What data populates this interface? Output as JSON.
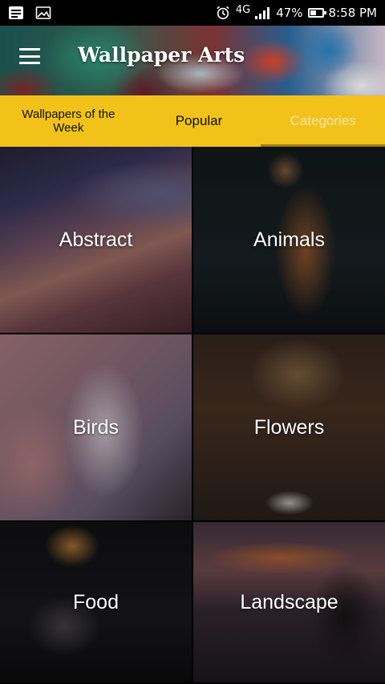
{
  "status_bar": {
    "network": "4G",
    "battery": "47%",
    "battery_level": 0.47,
    "time": "8:58 PM",
    "icons": [
      "message-icon",
      "image-icon",
      "alarm-icon",
      "signal-icon",
      "battery-icon"
    ]
  },
  "header": {
    "title": "Wallpaper Arts",
    "menu_icon": "hamburger-icon"
  },
  "tabs": [
    {
      "label": "Wallpapers of the Week",
      "active": false
    },
    {
      "label": "Popular",
      "active": false
    },
    {
      "label": "Categories",
      "active": true
    }
  ],
  "categories": [
    {
      "label": "Abstract"
    },
    {
      "label": "Animals"
    },
    {
      "label": "Birds"
    },
    {
      "label": "Flowers"
    },
    {
      "label": "Food"
    },
    {
      "label": "Landscape"
    }
  ],
  "colors": {
    "tab_bar": "#f2c21a",
    "active_tab_text": "#f6e6a6",
    "active_indicator": "#9a7a10"
  }
}
